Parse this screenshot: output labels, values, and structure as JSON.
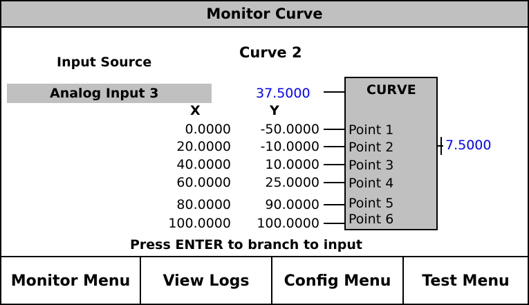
{
  "title": "Monitor Curve",
  "curve_name": "Curve 2",
  "input_source": {
    "label": "Input Source",
    "value": "Analog Input 3"
  },
  "curve_block": {
    "label": "CURVE",
    "input_value": "37.5000",
    "output_value": "7.5000",
    "x_header": "X",
    "y_header": "Y",
    "points": [
      {
        "label": "Point 1",
        "x": "0.0000",
        "y": "-50.0000"
      },
      {
        "label": "Point 2",
        "x": "20.0000",
        "y": "-10.0000"
      },
      {
        "label": "Point 3",
        "x": "40.0000",
        "y": "10.0000"
      },
      {
        "label": "Point 4",
        "x": "60.0000",
        "y": "25.0000"
      },
      {
        "label": "Point 5",
        "x": "80.0000",
        "y": "90.0000"
      },
      {
        "label": "Point 6",
        "x": "100.0000",
        "y": "100.0000"
      }
    ]
  },
  "hint": "Press ENTER to branch to input",
  "softkeys": [
    "Monitor Menu",
    "View Logs",
    "Config Menu",
    "Test Menu"
  ],
  "colors": {
    "value_blue": "#0000ff",
    "panel_gray": "#c0c0c0"
  }
}
